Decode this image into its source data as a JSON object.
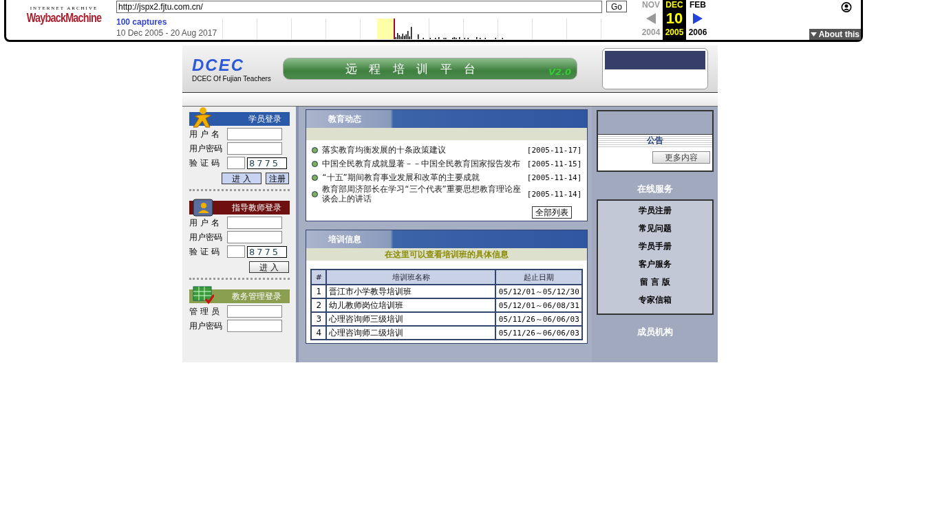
{
  "wayback": {
    "logo_top": "INTERNET ARCHIVE",
    "logo_main": "WaybackMachine",
    "url": "http://jspx2.fjtu.com.cn/",
    "go": "Go",
    "captures": "100 captures",
    "range": "10 Dec 2005 - 20 Aug 2017",
    "months": [
      {
        "label": "NOV",
        "year": "2004",
        "selected": false
      },
      {
        "label": "DEC",
        "day": "10",
        "year": "2005",
        "selected": true
      },
      {
        "label": "FEB",
        "year": "2006",
        "selected": false
      }
    ],
    "about": "About this"
  },
  "header": {
    "logo": "DCEC",
    "logo_sub": "DCEC Of Fujian Teachers",
    "banner": "远 程 培 训 平 台",
    "version": "V2.0"
  },
  "logins": [
    {
      "title": "学员登录",
      "color": "#2a5aa8",
      "fields": [
        "用 户 名",
        "用户密码"
      ],
      "captcha_label": "验 证 码",
      "captcha": "8775",
      "buttons": [
        "进 入",
        "注册"
      ]
    },
    {
      "title": "指导教师登录",
      "color": "#6e1010",
      "fields": [
        "用 户 名",
        "用户密码"
      ],
      "captcha_label": "验 证 码",
      "captcha": "8775",
      "buttons": [
        "进 入"
      ]
    },
    {
      "title": "教务管理登录",
      "color": "#8aa050",
      "fields": [
        "管 理 员",
        "用户密码"
      ]
    }
  ],
  "news": {
    "title": "教育动态",
    "items": [
      {
        "title": "落实教育均衡发展的十条政策建议",
        "date": "[2005-11-17]"
      },
      {
        "title": "中国全民教育成就显著－－中国全民教育国家报告发布",
        "date": "[2005-11-15]"
      },
      {
        "title": "“十五”期间教育事业发展和改革的主要成就",
        "date": "[2005-11-14]"
      },
      {
        "title": "教育部周济部长在学习“三个代表”重要思想教育理论座谈会上的讲话",
        "date": "[2005-11-14]"
      }
    ],
    "button": "全部列表"
  },
  "training": {
    "title": "培训信息",
    "subtitle": "在这里可以查看培训班的具体信息",
    "columns": [
      "#",
      "培训班名称",
      "起止日期"
    ],
    "rows": [
      [
        "1",
        "晋江市小学教导培训班",
        "05/12/01～05/12/30"
      ],
      [
        "2",
        "幼儿教师岗位培训班",
        "05/12/01～06/08/31"
      ],
      [
        "3",
        "心理咨询师三级培训",
        "05/11/26～06/06/03"
      ],
      [
        "4",
        "心理咨询师二级培训",
        "05/11/26～06/06/03"
      ]
    ]
  },
  "notice": {
    "title": "公告",
    "button": "更多内容"
  },
  "services": {
    "title": "在线服务",
    "items": [
      "学员注册",
      "常见问题",
      "学员手册",
      "客户服务",
      "留 言 版",
      "专家信箱"
    ]
  },
  "members": {
    "title": "成员机构"
  }
}
